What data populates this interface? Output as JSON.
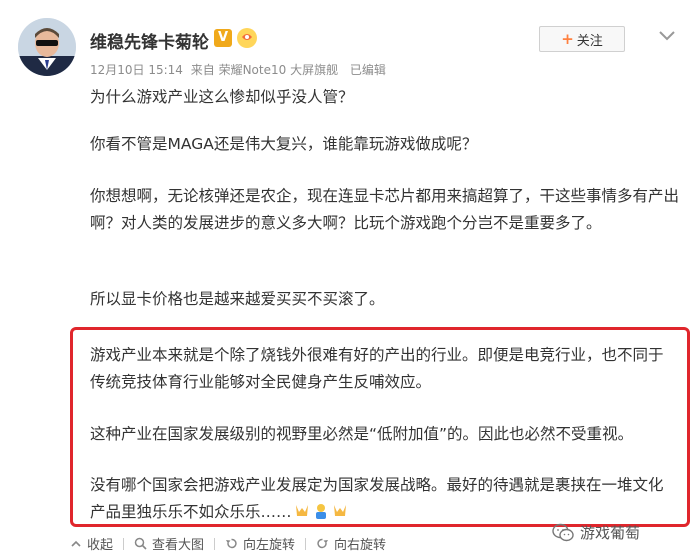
{
  "post": {
    "username": "维稳先锋卡菊轮",
    "verified_badge": "V",
    "follow_label": "关注",
    "follow_plus": "+",
    "meta": {
      "timestamp": "12月10日 15:14",
      "source": "来自 荣耀Note10 大屏旗舰",
      "edited": "已编辑"
    },
    "paragraphs": [
      "为什么游戏产业这么惨却似乎没人管？",
      "你看不管是MAGA还是伟大复兴，谁能靠玩游戏做成呢？",
      "你想想啊，无论核弹还是农企，现在连显卡芯片都用来搞超算了，干这些事情多有产出啊？对人类的发展进步的意义多大啊？比玩个游戏跑个分岂不是重要多了。",
      "所以显卡价格也是越来越爱买买不买滚了。"
    ],
    "highlighted_paragraphs": [
      "游戏产业本来就是个除了烧钱外很难有好的产出的行业。即便是电竞行业，也不同于传统竞技体育行业能够对全民健身产生反哺效应。",
      "这种产业在国家发展级别的视野里必然是“低附加值”的。因此也必然不受重视。",
      "没有哪个国家会把游戏产业发展定为国家发展战略。最好的待遇就是裹挟在一堆文化产品里独乐乐不如众乐乐……"
    ]
  },
  "toolbar": {
    "collapse": "收起",
    "view_large": "查看大图",
    "rotate_left": "向左旋转",
    "rotate_right": "向右旋转"
  },
  "watermark": "游戏葡萄",
  "icons": {
    "avatar": "avatar-photo",
    "verified": "verified-v-icon",
    "fan": "fan-badge-icon",
    "more": "chevron-down-icon",
    "emojis": [
      "hands-up-emoji",
      "shrug-emoji",
      "hands-up-emoji"
    ],
    "watermark": "wechat-logo-icon"
  },
  "colors": {
    "highlight_border": "#e0262c",
    "accent": "#ff8140",
    "verified": "#f0a91b",
    "meta_text": "#8c8c8c"
  }
}
